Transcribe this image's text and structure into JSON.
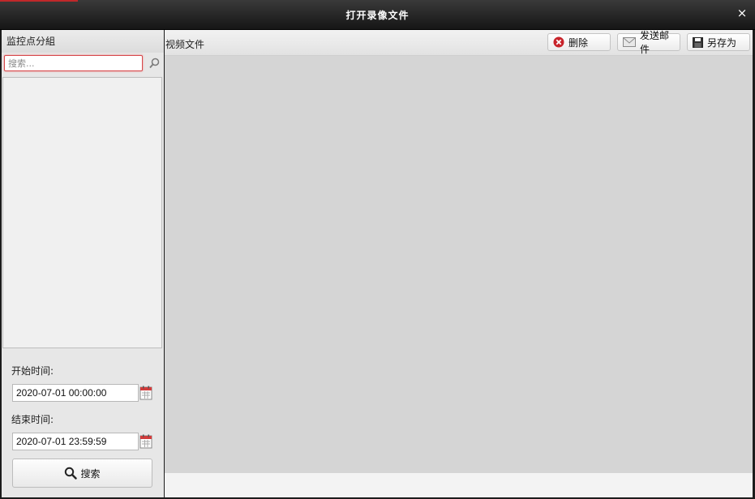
{
  "window": {
    "title": "打开录像文件",
    "close_glyph": "×"
  },
  "left_panel": {
    "header": "监控点分組",
    "search": {
      "placeholder": "搜索...",
      "value": ""
    },
    "start_time": {
      "label": "开始时间:",
      "value": "2020-07-01 00:00:00"
    },
    "end_time": {
      "label": "结束时间:",
      "value": "2020-07-01 23:59:59"
    },
    "search_button": "搜索"
  },
  "right_panel": {
    "header": "视频文件",
    "buttons": {
      "delete": "删除",
      "send_email": "发送邮件",
      "save_as": "另存为"
    }
  },
  "icons": {
    "close": "close-icon",
    "search": "search-icon",
    "calendar": "calendar-icon",
    "delete": "delete-icon",
    "email": "email-icon",
    "save": "save-icon"
  },
  "colors": {
    "accent": "#c0282a",
    "titlebar": "#1c1c1c",
    "content_bg": "#d5d5d5"
  }
}
